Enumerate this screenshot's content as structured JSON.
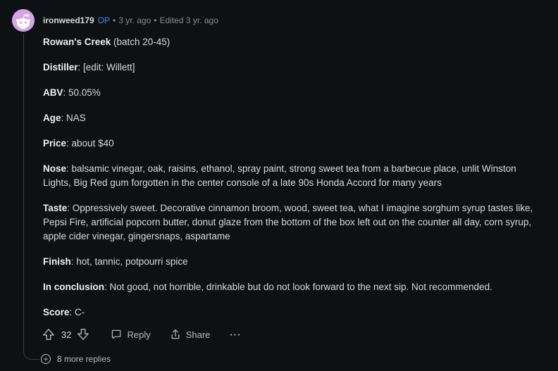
{
  "comment": {
    "username": "ironweed179",
    "op_badge": "OP",
    "time_ago": "3 yr. ago",
    "edited": "Edited 3 yr. ago",
    "avatar_color": "#d4a4e4",
    "paragraphs": [
      {
        "label": "Rowan's Creek",
        "text": " (batch 20-45)"
      },
      {
        "label": "Distiller",
        "text": ": [edit: Willett]"
      },
      {
        "label": "ABV",
        "text": ": 50.05%"
      },
      {
        "label": "Age",
        "text": ": NAS"
      },
      {
        "label": "Price",
        "text": ": about $40"
      },
      {
        "label": "Nose",
        "text": ": balsamic vinegar, oak, raisins, ethanol, spray paint, strong sweet tea from a barbecue place, unlit Winston Lights, Big Red gum forgotten in the center console of a late 90s Honda Accord for many years"
      },
      {
        "label": "Taste",
        "text": ": Oppressively sweet. Decorative cinnamon broom, wood, sweet tea, what I imagine sorghum syrup tastes like, Pepsi Fire, artificial popcorn butter, donut glaze from the bottom of the box left out on the counter all day, corn syrup, apple cider vinegar, gingersnaps, aspartame"
      },
      {
        "label": "Finish",
        "text": ": hot, tannic, potpourri spice"
      },
      {
        "label": "In conclusion",
        "text": ": Not good, not horrible, drinkable but do not look forward to the next sip. Not recommended."
      },
      {
        "label": "Score",
        "text": ": C-"
      }
    ]
  },
  "actions": {
    "upvote_icon": "upvote-arrow-icon",
    "vote_count": "32",
    "downvote_icon": "downvote-arrow-icon",
    "reply_label": "Reply",
    "reply_icon": "speech-bubble-icon",
    "share_label": "Share",
    "share_icon": "share-arrow-icon",
    "more_label": "···"
  },
  "more_replies": {
    "label": "8 more replies",
    "icon": "plus-circle-icon"
  },
  "colors": {
    "background": "#0e1113",
    "text": "#d7dadc",
    "muted": "#8a8d90",
    "op_blue": "#3d8bfd"
  }
}
